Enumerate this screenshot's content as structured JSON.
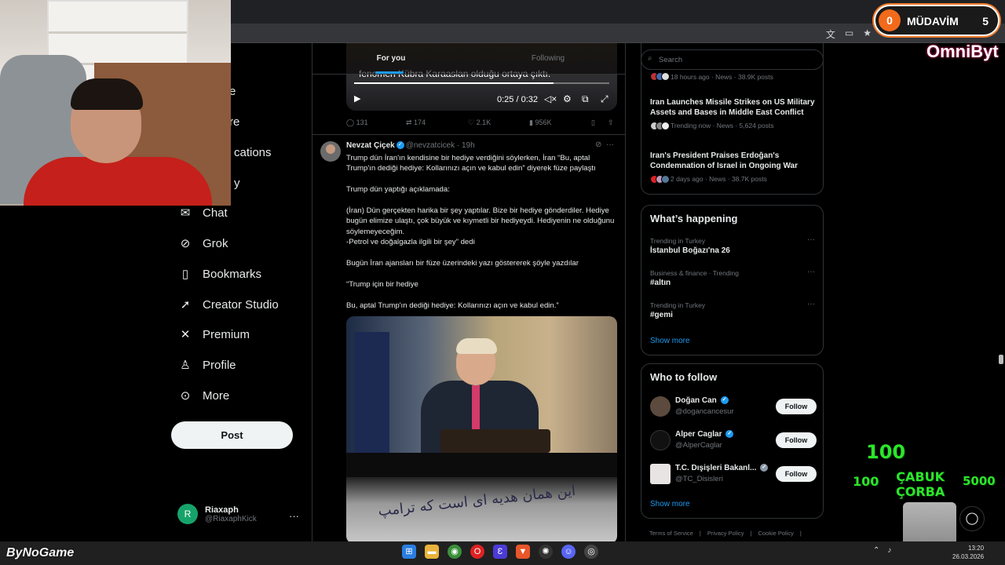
{
  "overlay": {
    "mudavim_label": "MÜDAVİM",
    "mudavim_left": "0",
    "mudavim_right": "5",
    "omni": "OmniByt",
    "green_top": "100",
    "green_left": "100",
    "green_right": "5000",
    "corba_line1": "ÇABUK",
    "corba_line2": "ÇORBA",
    "bynogame": "ByNoGame"
  },
  "nav": {
    "items": [
      {
        "label": "Chat",
        "icon": "chat-icon"
      },
      {
        "label": "Grok",
        "icon": "grok-icon"
      },
      {
        "label": "Bookmarks",
        "icon": "bookmark-icon"
      },
      {
        "label": "Creator Studio",
        "icon": "rocket-icon"
      },
      {
        "label": "Premium",
        "icon": "x-icon"
      },
      {
        "label": "Profile",
        "icon": "person-icon"
      },
      {
        "label": "More",
        "icon": "more-circle-icon"
      }
    ],
    "partial": [
      "e",
      "re",
      "cations",
      "y"
    ],
    "post_label": "Post",
    "user_name": "Riaxaph",
    "user_handle": "@RiaxaphKick",
    "avatar_letter": "R"
  },
  "tabs": {
    "for_you": "For you",
    "following": "Following"
  },
  "video": {
    "caption": "fenomen Kübra Karaaslan olduğu ortaya çıktı.",
    "time": "0:25 / 0:32",
    "progress": 0.78
  },
  "prev_actions": {
    "replies": "131",
    "reposts": "174",
    "likes": "2.1K",
    "views": "956K"
  },
  "tweet": {
    "name": "Nevzat Çiçek",
    "handle": "@nevzatcicek",
    "time": "· 19h",
    "paragraphs": [
      "Trump dün İran'ın kendisine bir hediye verdiğini söylerken, İran “Bu, aptal Trump'ın dediği hediye: Kollarınızı açın ve kabul edin” diyerek füze paylaştı",
      "Trump dün yaptığı açıklamada:",
      "(İran) Dün gerçekten harika bir şey yaptılar. Bize bir hediye gönderdiler. Hediye bugün elimize ulaştı, çok büyük ve kıymetli bir hediyeydi. Hediyenin ne olduğunu söylemeyeceğim.\n-Petrol ve doğalgazla ilgili bir şey” dedi",
      "Bugün İran ajansları bir füze üzerindeki yazı göstererek şöyle yazdılar",
      "“Trump için bir hediye",
      "Bu, aptal Trump'ın dediği hediye: Kollarınızı açın ve kabul edin.”"
    ],
    "media_script": "این همان هدیه ای است که ترامپ"
  },
  "search": {
    "placeholder": "Search"
  },
  "news": [
    {
      "title": "",
      "meta": "18 hours ago · News · 38.9K posts"
    },
    {
      "title": "Iran Launches Missile Strikes on US Military Assets and Bases in Middle East Conflict",
      "meta": "Trending now · News · 5,624 posts"
    },
    {
      "title": "Iran's President Praises Erdoğan's Condemnation of Israel in Ongoing War",
      "meta": "2 days ago · News · 38.7K posts"
    }
  ],
  "happening": {
    "title": "What’s happening",
    "trends": [
      {
        "meta": "Trending in Turkey",
        "name": "İstanbul Boğazı'na 26"
      },
      {
        "meta": "Business & finance · Trending",
        "name": "#altın"
      },
      {
        "meta": "Trending in Turkey",
        "name": "#gemi"
      }
    ],
    "show_more": "Show more"
  },
  "who_to_follow": {
    "title": "Who to follow",
    "users": [
      {
        "name": "Doğan Can",
        "handle": "@dogancancesur",
        "verified": "blue"
      },
      {
        "name": "Alper Caglar",
        "handle": "@AlperCaglar",
        "verified": "blue"
      },
      {
        "name": "T.C. Dışişleri Bakanl...",
        "handle": "@TC_Disisleri",
        "verified": "gray"
      }
    ],
    "follow_label": "Follow",
    "show_more": "Show more"
  },
  "footer": {
    "links": [
      "Terms of Service",
      "|",
      "Privacy Policy",
      "|",
      "Cookie Policy",
      "|"
    ]
  },
  "taskbar": {
    "time": "13:20",
    "date": "26.03.2026"
  },
  "colors": {
    "accent": "#1d9bf0",
    "bg": "#000000",
    "border": "#2f3336",
    "muted": "#71767b"
  }
}
